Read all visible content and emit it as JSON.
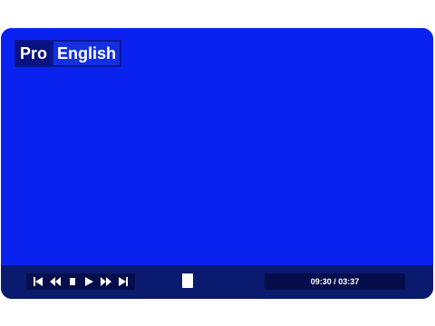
{
  "logo": {
    "part1": "Pro",
    "part2": "English"
  },
  "controls": {
    "buttons": [
      {
        "name": "skip-back-icon"
      },
      {
        "name": "rewind-icon"
      },
      {
        "name": "stop-icon"
      },
      {
        "name": "play-icon"
      },
      {
        "name": "fast-forward-icon"
      },
      {
        "name": "skip-forward-icon"
      }
    ],
    "time_display": "09:30 / 03:37"
  },
  "colors": {
    "screen": "#0a22f0",
    "control_bar": "#0a1a6e",
    "panel": "#050d4a"
  }
}
